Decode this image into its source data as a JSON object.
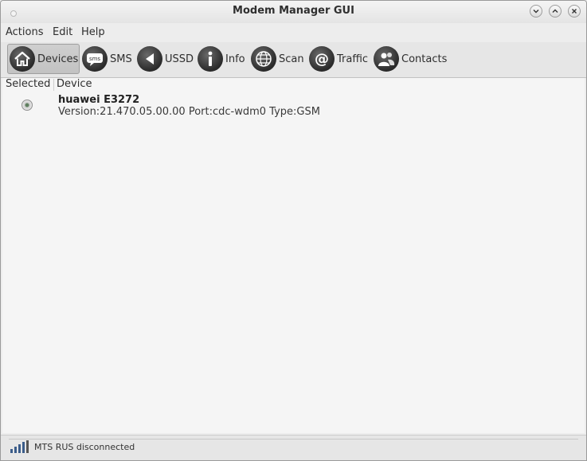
{
  "window": {
    "title": "Modem Manager GUI"
  },
  "menu": {
    "items": [
      "Actions",
      "Edit",
      "Help"
    ]
  },
  "toolbar": {
    "items": [
      {
        "label": "Devices",
        "icon": "home-icon",
        "active": true
      },
      {
        "label": "SMS",
        "icon": "sms-icon",
        "active": false
      },
      {
        "label": "USSD",
        "icon": "ussd-icon",
        "active": false
      },
      {
        "label": "Info",
        "icon": "info-icon",
        "active": false
      },
      {
        "label": "Scan",
        "icon": "globe-icon",
        "active": false
      },
      {
        "label": "Traffic",
        "icon": "at-icon",
        "active": false
      },
      {
        "label": "Contacts",
        "icon": "contacts-icon",
        "active": false
      }
    ]
  },
  "devices": {
    "columns": [
      "Selected",
      "Device"
    ],
    "rows": [
      {
        "selected": true,
        "name": "huawei E3272",
        "info": "Version:21.470.05.00.00 Port:cdc-wdm0 Type:GSM"
      }
    ]
  },
  "status": {
    "text": "MTS RUS disconnected",
    "signal_bars": 4,
    "signal_icon": "signal-strength-icon"
  },
  "colors": {
    "window_bg": "#ededed",
    "content_bg": "#f5f5f5",
    "icon_dark": "#2a2a2a"
  }
}
